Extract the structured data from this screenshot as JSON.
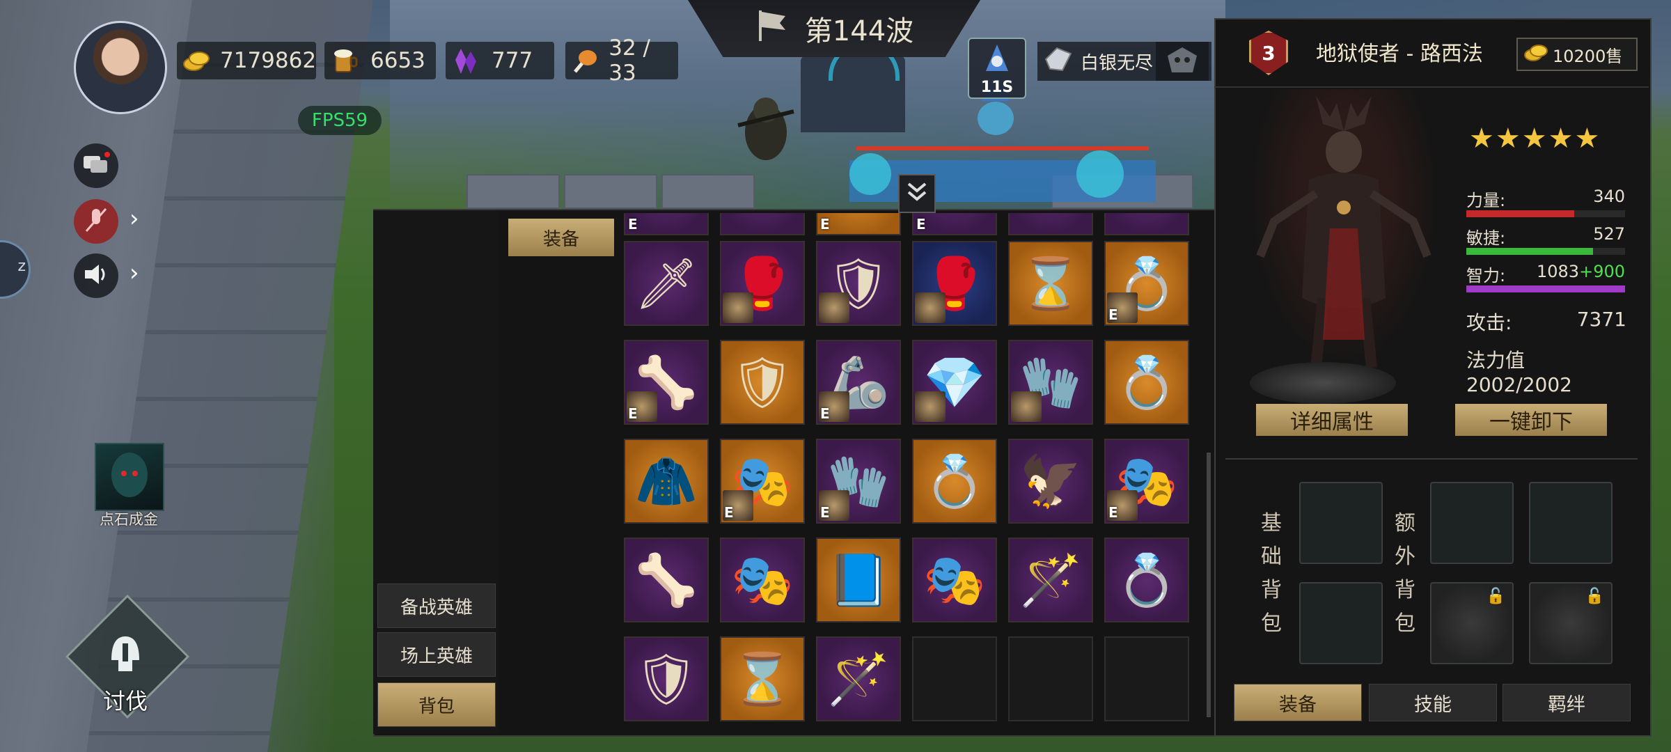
{
  "wave": {
    "label": "第144波"
  },
  "resources": {
    "gold": "7179862",
    "wood": "6653",
    "crystal": "777",
    "population": "32 / 33"
  },
  "fps": "FPS59",
  "timer": "11S",
  "mode": {
    "label": "白银无尽"
  },
  "left": {
    "alchemy_label": "点石成金",
    "crusade_label": "讨伐"
  },
  "bag": {
    "category": "装备",
    "tabs": [
      "备战英雄",
      "场上英雄",
      "背包"
    ],
    "active_tab": "背包",
    "items": [
      {
        "bg": "purple",
        "icon": "sword-icon",
        "glyph": "🗡",
        "hero": false
      },
      {
        "bg": "purple",
        "icon": "gauntlet-icon",
        "glyph": "🥊",
        "hero": true
      },
      {
        "bg": "purple",
        "icon": "armor-icon",
        "glyph": "🛡",
        "hero": true
      },
      {
        "bg": "blue",
        "icon": "gauntlet-icon",
        "glyph": "🥊",
        "hero": true
      },
      {
        "bg": "orange",
        "icon": "hourglass-icon",
        "glyph": "⌛",
        "hero": false
      },
      {
        "bg": "orange",
        "icon": "ring-icon",
        "glyph": "💍",
        "hero": true,
        "e": true
      },
      {
        "bg": "purple",
        "icon": "bracer-icon",
        "glyph": "🦴",
        "hero": true,
        "e": true
      },
      {
        "bg": "orange",
        "icon": "armor-icon",
        "glyph": "🛡",
        "hero": false
      },
      {
        "bg": "purple",
        "icon": "gauntlet-icon",
        "glyph": "🦾",
        "hero": true,
        "e": true
      },
      {
        "bg": "purple",
        "icon": "crystal-icon",
        "glyph": "💎",
        "hero": true
      },
      {
        "bg": "purple",
        "icon": "glove-icon",
        "glyph": "🧤",
        "hero": true
      },
      {
        "bg": "orange",
        "icon": "ring-icon",
        "glyph": "💍",
        "hero": false
      },
      {
        "bg": "orange",
        "icon": "cloak-icon",
        "glyph": "🧥",
        "hero": false
      },
      {
        "bg": "orange",
        "icon": "mask-icon",
        "glyph": "🎭",
        "hero": true,
        "e": true
      },
      {
        "bg": "purple",
        "icon": "glove-icon",
        "glyph": "🧤",
        "hero": true,
        "e": true
      },
      {
        "bg": "orange",
        "icon": "ring-icon",
        "glyph": "💍",
        "hero": false
      },
      {
        "bg": "purple",
        "icon": "claw-icon",
        "glyph": "🦅",
        "hero": false
      },
      {
        "bg": "purple",
        "icon": "mask-icon",
        "glyph": "🎭",
        "hero": true,
        "e": true
      },
      {
        "bg": "purple",
        "icon": "bracer-icon",
        "glyph": "🦴",
        "hero": false
      },
      {
        "bg": "purple",
        "icon": "mask-icon",
        "glyph": "🎭",
        "hero": false
      },
      {
        "bg": "orange",
        "icon": "book-icon",
        "glyph": "📘",
        "hero": false
      },
      {
        "bg": "purple",
        "icon": "mask-icon",
        "glyph": "🎭",
        "hero": false
      },
      {
        "bg": "purple",
        "icon": "staff-icon",
        "glyph": "🪄",
        "hero": false
      },
      {
        "bg": "purple",
        "icon": "ring-icon",
        "glyph": "💍",
        "hero": false
      },
      {
        "bg": "purple",
        "icon": "armor-icon",
        "glyph": "🛡",
        "hero": false
      },
      {
        "bg": "orange",
        "icon": "hourglass-icon",
        "glyph": "⌛",
        "hero": false
      },
      {
        "bg": "purple",
        "icon": "staff-icon",
        "glyph": "🪄",
        "hero": false
      },
      {
        "bg": "empty"
      },
      {
        "bg": "empty"
      },
      {
        "bg": "empty"
      }
    ]
  },
  "hero": {
    "level": "3",
    "name": "地狱使者 - 路西法",
    "sell": "10200售",
    "stars": "★★★★★",
    "stats": {
      "str_label": "力量:",
      "str_value": "340",
      "str_fill": 0.68,
      "agi_label": "敏捷:",
      "agi_value": "527",
      "agi_fill": 0.8,
      "int_label": "智力:",
      "int_value": "1083",
      "int_bonus": "+900",
      "int_fill": 1.0
    },
    "attack_label": "攻击:",
    "attack_value": "7371",
    "mana": "法力值2002/2002",
    "detail_button": "详细属性",
    "unequip_button": "一键卸下",
    "base_pack_label": [
      "基",
      "础",
      "背",
      "包"
    ],
    "extra_pack_label": [
      "额",
      "外",
      "背",
      "包"
    ],
    "tabs": [
      "装备",
      "技能",
      "羁绊"
    ]
  },
  "colors": {
    "gold_button": "#c8ae76",
    "str_bar": "#c42a2a",
    "agi_bar": "#3cb83c",
    "int_bar": "#a03ac8",
    "fps_text": "#35e06a",
    "int_bonus": "#4ee04e"
  }
}
